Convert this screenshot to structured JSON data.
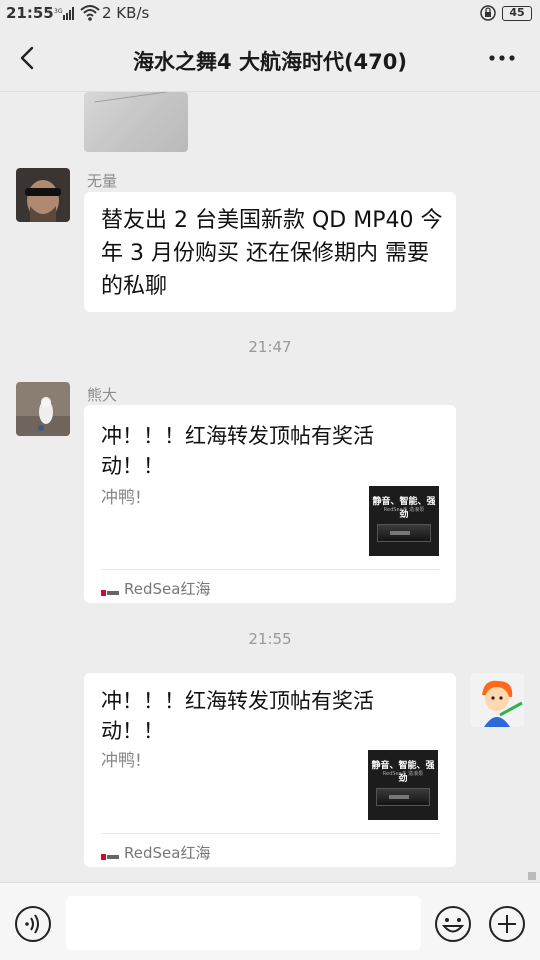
{
  "status_bar": {
    "time": "21:55",
    "network": "3G",
    "speed": "2 KB/s",
    "battery": "45"
  },
  "header": {
    "title": "海水之舞4 大航海时代(470)"
  },
  "messages": [
    {
      "sender": "无量",
      "text": "替友出 2 台美国新款 QD MP40 今年 3 月份购买 还在保修期内 需要的私聊"
    },
    {
      "divider": "21:47"
    },
    {
      "sender": "熊大",
      "card": {
        "title": "冲！！！红海转发顶帖有奖活动！！",
        "desc": "冲鸭!",
        "thumb_title": "静音、智能、强劲",
        "thumb_sub": "RedSea® 造浪泵",
        "source": "RedSea红海"
      }
    },
    {
      "divider": "21:55"
    },
    {
      "sender": "me",
      "card": {
        "title": "冲！！！红海转发顶帖有奖活动！！",
        "desc": "冲鸭!",
        "thumb_title": "静音、智能、强劲",
        "thumb_sub": "RedSea® 造浪泵",
        "source": "RedSea红海"
      }
    }
  ],
  "input": {
    "value": ""
  },
  "colors": {
    "background": "#ededed",
    "bubble": "#ffffff",
    "accent": "#111111"
  }
}
